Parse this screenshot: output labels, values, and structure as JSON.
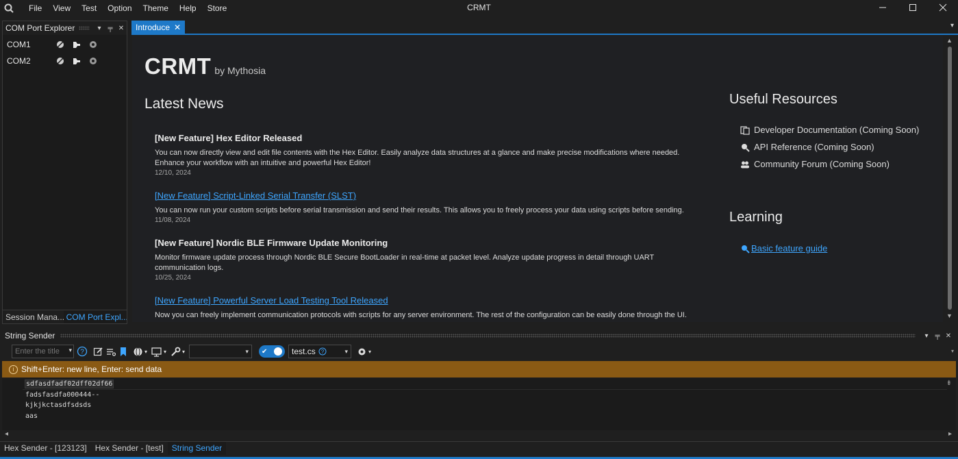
{
  "window": {
    "title": "CRMT",
    "controls": [
      "minimize",
      "maximize",
      "close"
    ]
  },
  "menu": [
    "File",
    "View",
    "Test",
    "Option",
    "Theme",
    "Help",
    "Store"
  ],
  "left_panel": {
    "title": "COM Port Explorer",
    "ports": [
      {
        "name": "COM1"
      },
      {
        "name": "COM2"
      }
    ],
    "tabs": [
      {
        "label": "Session Mana..."
      },
      {
        "label": "COM Port Expl..."
      }
    ]
  },
  "document": {
    "tab_label": "Introduce",
    "brand": {
      "name": "CRMT",
      "by": "by Mythosia"
    },
    "latest_news_heading": "Latest News",
    "news": [
      {
        "title": "[New Feature] Hex Editor Released",
        "body": "You can now directly view and edit file contents with the Hex Editor. Easily analyze data structures at a glance and make precise modifications where needed. Enhance your workflow with an intuitive and powerful Hex Editor!",
        "date": "12/10, 2024",
        "link": false
      },
      {
        "title": "[New Feature] Script-Linked Serial Transfer (SLST)",
        "body": "You can now run your custom scripts before serial transmission and send their results. This allows you to freely process your data using scripts before sending.",
        "date": "11/08, 2024",
        "link": true
      },
      {
        "title": "[New Feature] Nordic BLE Firmware Update Monitoring",
        "body": "Monitor firmware update process through Nordic BLE Secure BootLoader in real-time at packet level. Analyze update progress in detail through UART communication logs.",
        "date": "10/25, 2024",
        "link": false
      },
      {
        "title": "[New Feature] Powerful Server Load Testing Tool Released",
        "body": "Now you can freely implement communication protocols with scripts for any server environment. The rest of the configuration can be easily done through the UI.",
        "date": "",
        "link": true
      }
    ],
    "resources_heading": "Useful Resources",
    "resources": [
      {
        "label": "Developer Documentation (Coming Soon)",
        "icon": "docs-icon"
      },
      {
        "label": "API Reference (Coming Soon)",
        "icon": "search-icon"
      },
      {
        "label": "Community Forum (Coming Soon)",
        "icon": "users-icon"
      }
    ],
    "learning_heading": "Learning",
    "learning_link": "Basic feature guide"
  },
  "string_sender": {
    "title": "String Sender",
    "title_input_placeholder": "Enter the title",
    "script_combo_value": "test.cs",
    "hint": "Shift+Enter: new line, Enter: send data",
    "lines": [
      "sdfasdfadf02dff02df66",
      "fadsfasdfa000444--",
      "kjkjkctasdfsdsds",
      "aas"
    ]
  },
  "bottom_tabs": [
    {
      "label": "Hex Sender - [123123]"
    },
    {
      "label": "Hex Sender - [test]"
    },
    {
      "label": "String Sender"
    }
  ],
  "colors": {
    "accent": "#1e79c8",
    "link": "#3ea6ff",
    "hint_bar": "#8a5a14"
  }
}
